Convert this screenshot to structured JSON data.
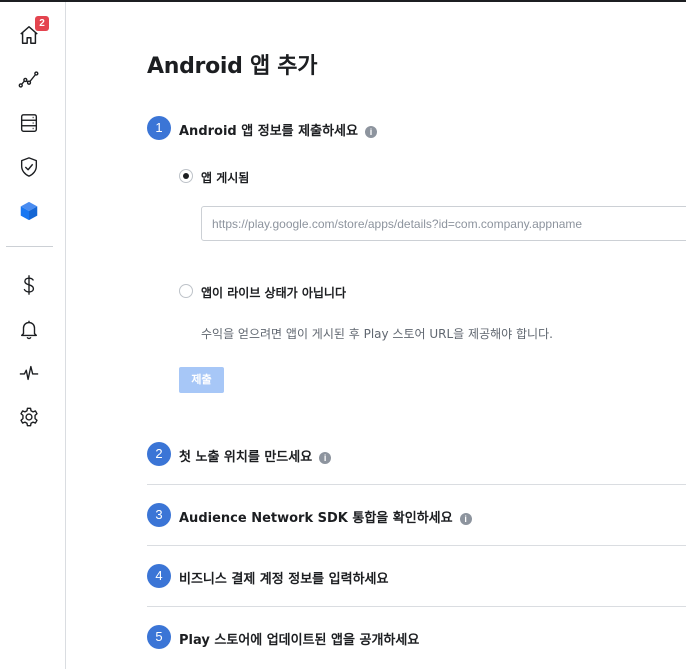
{
  "sidebar": {
    "home_badge": "2",
    "items": [
      {
        "name": "home-icon"
      },
      {
        "name": "analytics-icon"
      },
      {
        "name": "database-icon"
      },
      {
        "name": "shield-check-icon"
      },
      {
        "name": "cube-icon"
      },
      {
        "name": "dollar-icon"
      },
      {
        "name": "bell-icon"
      },
      {
        "name": "activity-icon"
      },
      {
        "name": "gear-icon"
      }
    ],
    "active_color": "#1877f2"
  },
  "page": {
    "title": "Android 앱 추가"
  },
  "steps": [
    {
      "number": "1",
      "title": "Android 앱 정보를 제출하세요",
      "info": "i"
    },
    {
      "number": "2",
      "title": "첫 노출 위치를 만드세요",
      "info": "i"
    },
    {
      "number": "3",
      "title": "Audience Network SDK 통합을 확인하세요",
      "info": "i"
    },
    {
      "number": "4",
      "title": "비즈니스 결제 계정 정보를 입력하세요"
    },
    {
      "number": "5",
      "title": "Play 스토어에 업데이트된 앱을 공개하세요"
    }
  ],
  "form": {
    "option_published": "앱 게시됨",
    "url_placeholder": "https://play.google.com/store/apps/details?id=com.company.appname",
    "url_value": "",
    "option_not_live": "앱이 라이브 상태가 아닙니다",
    "helper_text": "수익을 얻으려면 앱이 게시된 후 Play 스토어 URL을 제공해야 합니다.",
    "submit_label": "제출",
    "selected_option": "published"
  },
  "colors": {
    "step_circle": "#3b75d6",
    "submit_disabled": "#a7c7f7"
  }
}
